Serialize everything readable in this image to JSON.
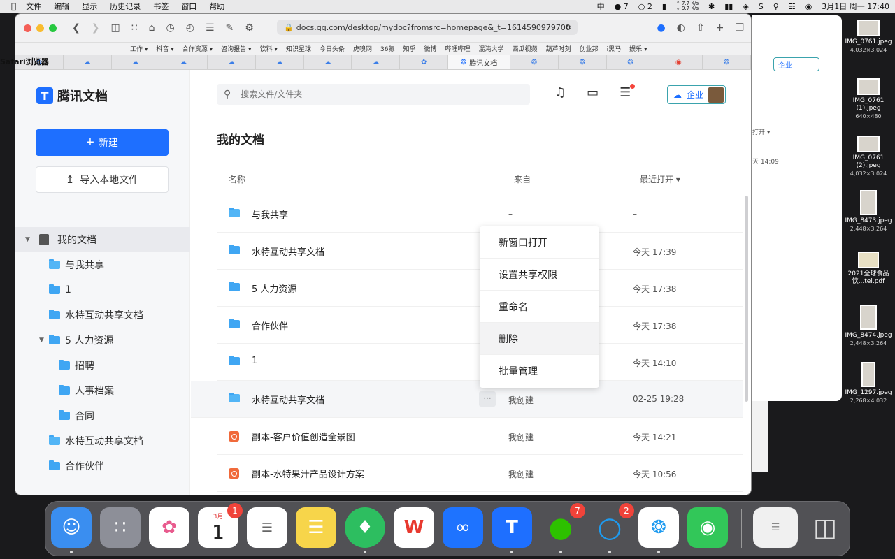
{
  "menubar": {
    "apple": "",
    "app_name": "Safari浏览器",
    "items": [
      "文件",
      "编辑",
      "显示",
      "历史记录",
      "书签",
      "窗口",
      "帮助"
    ],
    "status": {
      "ime": "中",
      "wechat_count": "7",
      "qq_count": "2",
      "net_up": "↑ 7.7 K/s",
      "net_down": "↓ 9.7 K/s",
      "datetime": "3月1日 周一  17:40"
    }
  },
  "browser": {
    "url": "docs.qq.com/desktop/mydoc?fromsrc=homepage&_t=1614590979700",
    "bookmarks": [
      "工作 ▾",
      "抖音 ▾",
      "合作资源 ▾",
      "咨询报告 ▾",
      "饮料 ▾",
      "知识星球",
      "今日头条",
      "虎嗅网",
      "36氪",
      "知乎",
      "微博",
      "哔哩哔哩",
      "混沌大学",
      "西瓜视频",
      "葫芦时刻",
      "创业邦",
      "i黑马",
      "娱乐 ▾"
    ],
    "active_tab": "腾讯文档"
  },
  "sidebar": {
    "logo": "腾讯文档",
    "new_button": "新建",
    "import_button": "导入本地文件",
    "tree": {
      "root": "我的文档",
      "items": [
        "与我共享",
        "1",
        "水特互动共享文档",
        "5 人力资源",
        "招聘",
        "人事档案",
        "合同",
        "水特互动共享文档",
        "合作伙伴"
      ]
    }
  },
  "main": {
    "search_placeholder": "搜索文件/文件夹",
    "enterprise": "企业",
    "page_title": "我的文档",
    "columns": {
      "name": "名称",
      "from": "来自",
      "recent": "最近打开 ▾"
    },
    "rows": [
      {
        "name": "与我共享",
        "from": "–",
        "time": "–"
      },
      {
        "name": "水特互动共享文档",
        "from": "",
        "time": "今天 17:39"
      },
      {
        "name": "5 人力资源",
        "from": "",
        "time": "今天 17:38"
      },
      {
        "name": "合作伙伴",
        "from": "",
        "time": "今天 17:38"
      },
      {
        "name": "1",
        "from": "",
        "time": "今天 14:10"
      },
      {
        "name": "水特互动共享文档",
        "from": "我创建",
        "time": "02-25 19:28"
      },
      {
        "name": "副本-客户价值创造全景图",
        "from": "我创建",
        "time": "今天 14:21"
      },
      {
        "name": "副本-水特果汁产品设计方案",
        "from": "我创建",
        "time": "今天 10:56"
      }
    ],
    "more_button": "···",
    "context_menu": [
      "新窗口打开",
      "设置共享权限",
      "重命名",
      "删除",
      "批量管理"
    ]
  },
  "background_window": {
    "button": "企业",
    "sort": "打开 ▾",
    "time": "天 14:09"
  },
  "desktop_files": [
    {
      "name": "IMG_0761.jpeg",
      "meta": "4,032×3,024"
    },
    {
      "name": "IMG_0761 (1).jpeg",
      "meta": "640×480"
    },
    {
      "name": "IMG_0761 (2).jpeg",
      "meta": "4,032×3,024"
    },
    {
      "name": "IMG_8473.jpeg",
      "meta": "2,448×3,264"
    },
    {
      "name": "2021全球食品饮...tel.pdf",
      "meta": ""
    },
    {
      "name": "IMG_8474.jpeg",
      "meta": "2,448×3,264"
    },
    {
      "name": "IMG_1297.jpeg",
      "meta": "2,268×4,032"
    }
  ],
  "dock": {
    "calendar_month": "3月",
    "calendar_day": "1",
    "calendar_badge": "1",
    "wechat_badge": "7",
    "qq_badge": "2"
  }
}
